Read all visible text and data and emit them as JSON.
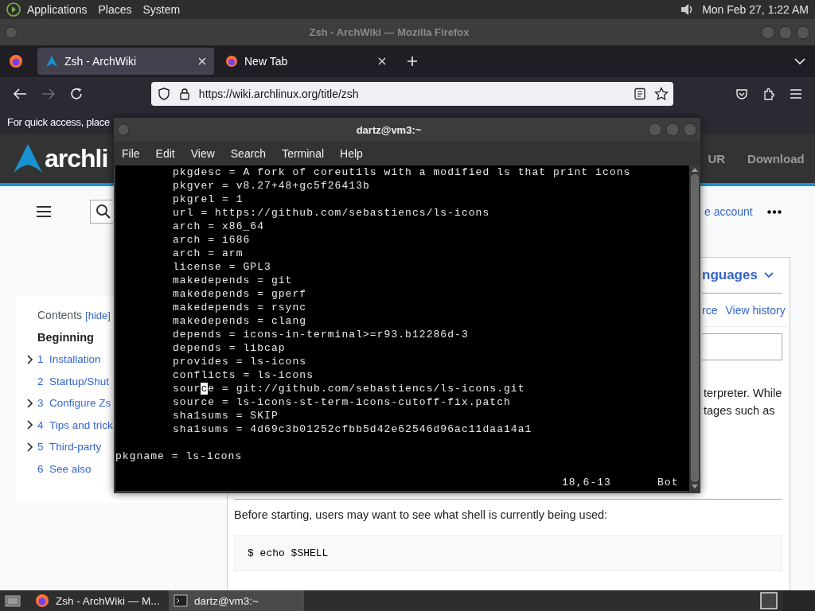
{
  "top_panel": {
    "menus": [
      "Applications",
      "Places",
      "System"
    ],
    "clock": "Mon Feb 27, 1:22 AM"
  },
  "browser": {
    "title": "Zsh - ArchWiki — Mozilla Firefox",
    "tabs": [
      {
        "label": "Zsh - ArchWiki",
        "kind": "arch",
        "selected": true
      },
      {
        "label": "New Tab",
        "kind": "firefox",
        "selected": false
      }
    ],
    "forward": {
      "disabled": true
    },
    "url": "https://wiki.archlinux.org/title/zsh",
    "bookmarks_hint": "For quick access, place"
  },
  "wiki": {
    "logo_text": "archli",
    "nav": [
      "UR",
      "Download"
    ],
    "account_link": "e account",
    "toc": {
      "title": "Contents",
      "toggle": "[hide]",
      "heading": "Beginning",
      "items": [
        {
          "number": "1",
          "label": "Installation",
          "expandable": true
        },
        {
          "number": "2",
          "label": "Startup/Shut",
          "expandable": false
        },
        {
          "number": "3",
          "label": "Configure Zs",
          "expandable": true
        },
        {
          "number": "4",
          "label": "Tips and trick",
          "expandable": true
        },
        {
          "number": "5",
          "label": "Third-party",
          "expandable": true
        },
        {
          "number": "6",
          "label": "See also",
          "expandable": false
        }
      ]
    },
    "languages": "nguages",
    "page_tabs": [
      "rce",
      "View history"
    ],
    "intro_lines": [
      "terpreter. While",
      "tages such as"
    ],
    "paragraph": "Before starting, users may want to see what shell is currently being used:",
    "code": "$ echo $SHELL"
  },
  "terminal": {
    "title": "dartz@vm3:~",
    "menus": [
      "File",
      "Edit",
      "View",
      "Search",
      "Terminal",
      "Help"
    ],
    "lines": [
      {
        "indent": true,
        "text": "pkgdesc = A fork of coreutils with a modified ls that print icons"
      },
      {
        "indent": true,
        "text": "pkgver = v8.27+48+gc5f26413b"
      },
      {
        "indent": true,
        "text": "pkgrel = 1"
      },
      {
        "indent": true,
        "text": "url = https://github.com/sebastiencs/ls-icons"
      },
      {
        "indent": true,
        "text": "arch = x86_64"
      },
      {
        "indent": true,
        "text": "arch = i686"
      },
      {
        "indent": true,
        "text": "arch = arm"
      },
      {
        "indent": true,
        "text": "license = GPL3"
      },
      {
        "indent": true,
        "text": "makedepends = git"
      },
      {
        "indent": true,
        "text": "makedepends = gperf"
      },
      {
        "indent": true,
        "text": "makedepends = rsync"
      },
      {
        "indent": true,
        "text": "makedepends = clang"
      },
      {
        "indent": true,
        "text": "depends = icons-in-terminal>=r93.b12286d-3"
      },
      {
        "indent": true,
        "text": "depends = libcap"
      },
      {
        "indent": true,
        "text": "provides = ls-icons"
      },
      {
        "indent": true,
        "text": "conflicts = ls-icons"
      },
      {
        "indent": true,
        "text": "sour",
        "cursor": "c",
        "after": "e = git://github.com/sebastiencs/ls-icons.git"
      },
      {
        "indent": true,
        "text": "source = ls-icons-st-term-icons-cutoff-fix.patch"
      },
      {
        "indent": true,
        "text": "sha1sums = SKIP"
      },
      {
        "indent": true,
        "text": "sha1sums = 4d69c3b01252cfbb5d42e62546d96ac11daa14a1"
      },
      {
        "indent": false,
        "text": "pkgname = ls-icons"
      }
    ],
    "status": {
      "position": "18,6-13",
      "scroll": "Bot"
    }
  },
  "taskbar": {
    "items": [
      {
        "label": "Zsh - ArchWiki — M...",
        "kind": "browser",
        "selected": false
      },
      {
        "label": "dartz@vm3:~",
        "kind": "terminal",
        "selected": true
      }
    ]
  }
}
